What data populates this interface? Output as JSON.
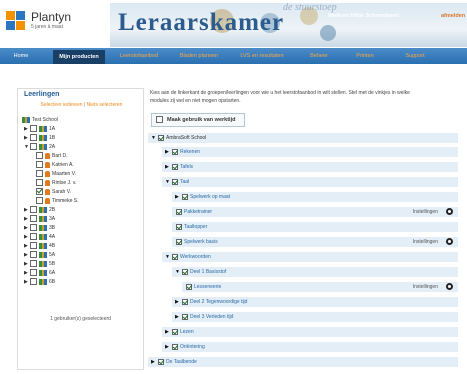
{
  "header": {
    "brand": "Plantyn",
    "brand_sub": "5 jaren à maat",
    "app_title": "Leraarskamer",
    "banner_word": "de stuurstoep",
    "welcome": "Welkom Hilde Schoonbaert",
    "welcome_link": "afmelden"
  },
  "nav": {
    "items": [
      {
        "label": "Home"
      },
      {
        "label": "Mijn producten"
      },
      {
        "label": "Leerstofaanbod"
      },
      {
        "label": "Bladen plannen"
      },
      {
        "label": "LVS en resultaten"
      },
      {
        "label": "Beheer"
      },
      {
        "label": "Printen"
      },
      {
        "label": "Support"
      }
    ]
  },
  "sidebar": {
    "title": "Leerlingen",
    "link_select_all": "Selecteer iedereen",
    "link_separator": "|",
    "link_none": "Niets selecteren",
    "school": "Test School",
    "groups": [
      "1A",
      "1B",
      "2A",
      "2B",
      "3A",
      "3B",
      "4A",
      "4B",
      "5A",
      "5B",
      "6A",
      "6B"
    ],
    "students": [
      "Bart D.",
      "Katrien A.",
      "Maarten V.",
      "Rintse J. v.",
      "Sarah V.",
      "Timmeke S."
    ],
    "footer": "1 gebruiker(s) geselecteerd"
  },
  "main": {
    "intro_a": "Kies aan de linkerkant de groepen/leerlingen voor wie u het leerstofaanbod in wilt stellen. Stel met de vinkjes in welke",
    "intro_b": "modules zij wel en niet mogen opstarten.",
    "tools_label": "Maak gebruik van werktijd",
    "settings_label": "Instellingen",
    "rows": [
      {
        "label": "AmbraSoft School"
      },
      {
        "label": "Rekenen"
      },
      {
        "label": "Tafels"
      },
      {
        "label": "Taal"
      },
      {
        "label": "Spelwerk op maat"
      },
      {
        "label": "Pakketrainer"
      },
      {
        "label": "Taaltopper"
      },
      {
        "label": "Spelwerk basis"
      },
      {
        "label": "Werkwoorden"
      },
      {
        "label": "Deel 1 Basisstof"
      },
      {
        "label": "Lesseneerie"
      },
      {
        "label": "Deel 2 Tegenwoordige tijd"
      },
      {
        "label": "Deel 3 Verleden tijd"
      },
      {
        "label": "Lezen"
      },
      {
        "label": "Oriëntering"
      },
      {
        "label": "De Taalbende"
      }
    ]
  }
}
